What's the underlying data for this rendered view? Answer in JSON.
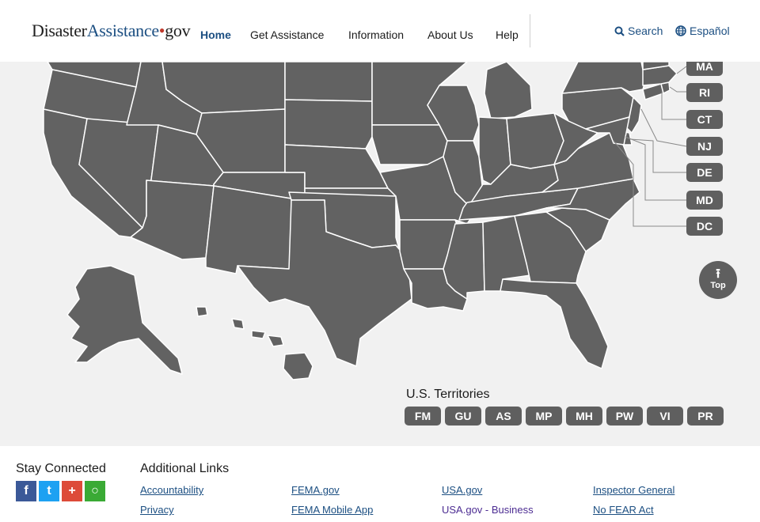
{
  "header": {
    "logo": {
      "part1": "Disaster",
      "part2": "Assistance",
      "dot": "•",
      "part3": "gov"
    },
    "nav": [
      "Home",
      "Get Assistance",
      "Information",
      "About Us",
      "Help"
    ],
    "search_label": "Search",
    "language_label": "Español"
  },
  "map": {
    "state_buttons": [
      "MA",
      "RI",
      "CT",
      "NJ",
      "DE",
      "MD",
      "DC"
    ],
    "top_button_label": "Top",
    "territories_title": "U.S. Territories",
    "territories": [
      "FM",
      "GU",
      "AS",
      "MP",
      "MH",
      "PW",
      "VI",
      "PR"
    ],
    "state_fill": "#626262",
    "background": "#f1f1f1"
  },
  "footer": {
    "stay_connected": "Stay Connected",
    "social": [
      {
        "name": "facebook-icon",
        "glyph": "f",
        "color": "#3b5998"
      },
      {
        "name": "twitter-icon",
        "glyph": "t",
        "color": "#1da1f2"
      },
      {
        "name": "google-plus-icon",
        "glyph": "+",
        "color": "#dd4b39"
      },
      {
        "name": "govdelivery-icon",
        "glyph": "○",
        "color": "#3aaa35"
      }
    ],
    "additional_links_title": "Additional Links",
    "links": [
      [
        "Accountability",
        "Privacy"
      ],
      [
        "FEMA.gov",
        "FEMA Mobile App"
      ],
      [
        "USA.gov",
        "USA.gov - Business"
      ],
      [
        "Inspector General",
        "No FEAR Act"
      ]
    ]
  }
}
